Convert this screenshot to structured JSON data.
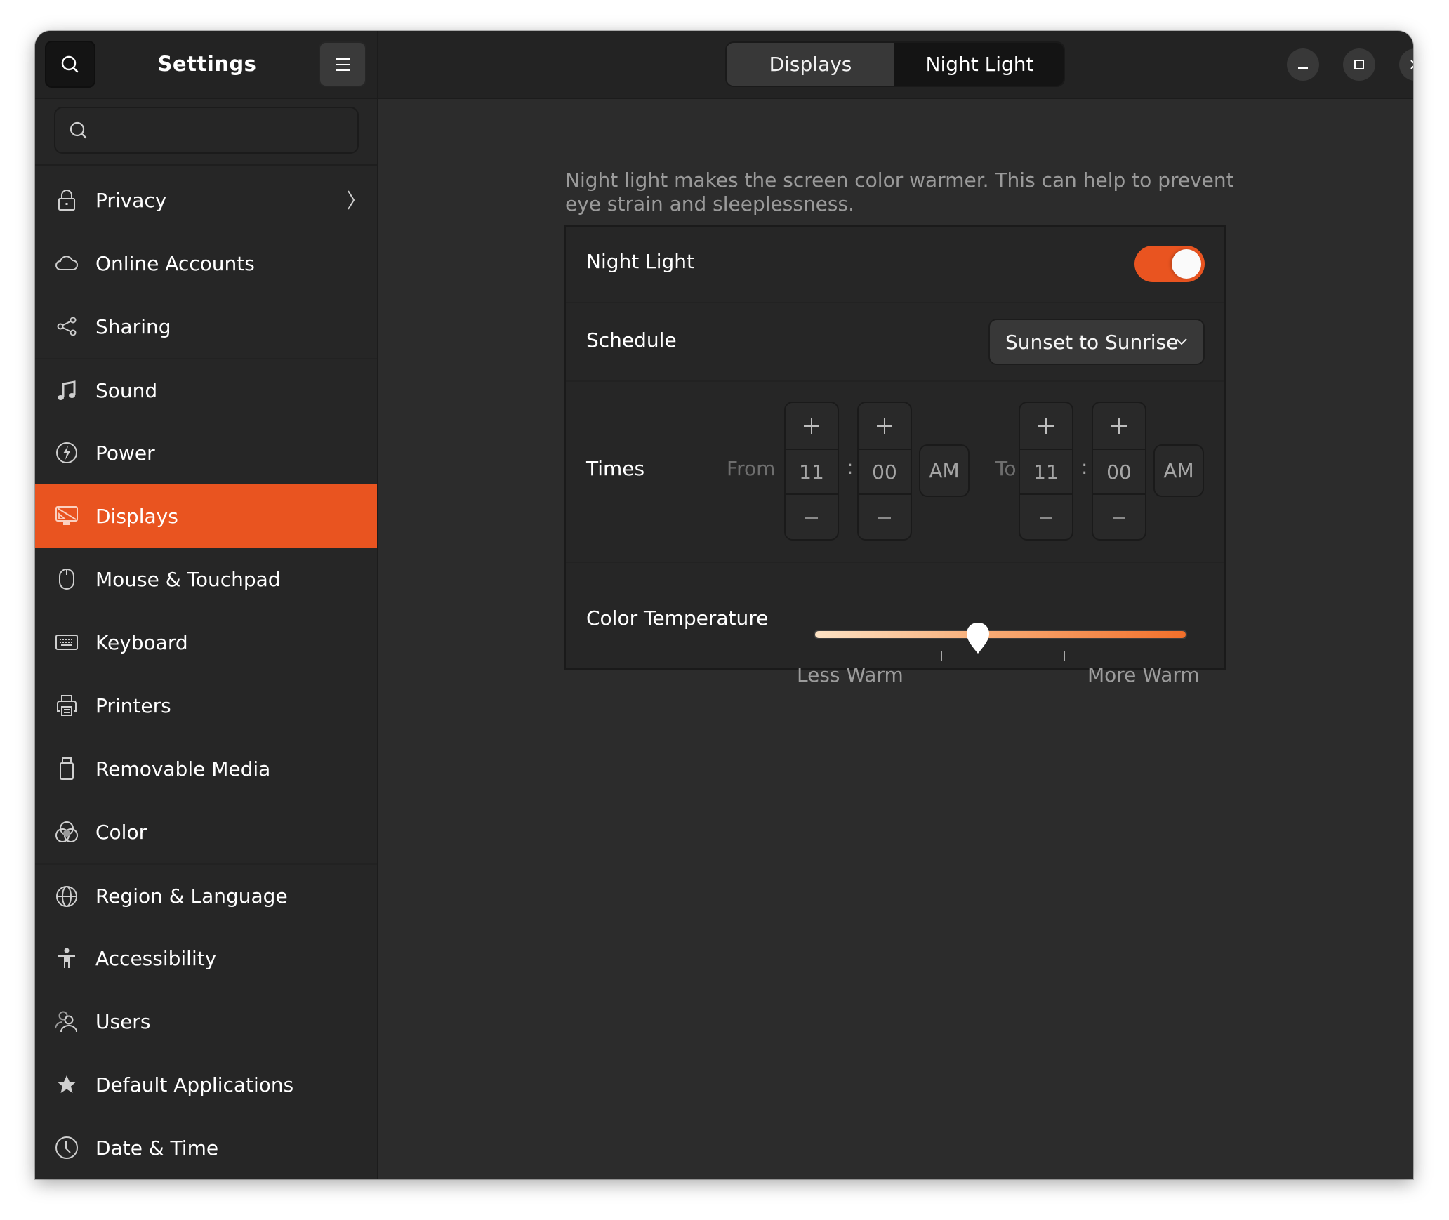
{
  "app": {
    "title": "Settings"
  },
  "sidebar": {
    "search_placeholder": "",
    "items": [
      {
        "label": "Privacy",
        "icon": "lock-icon",
        "has_chevron": true
      },
      {
        "label": "Online Accounts",
        "icon": "cloud-icon"
      },
      {
        "label": "Sharing",
        "icon": "share-icon"
      },
      {
        "label": "Sound",
        "icon": "music-note-icon"
      },
      {
        "label": "Power",
        "icon": "power-icon"
      },
      {
        "label": "Displays",
        "icon": "display-icon",
        "active": true
      },
      {
        "label": "Mouse & Touchpad",
        "icon": "mouse-icon"
      },
      {
        "label": "Keyboard",
        "icon": "keyboard-icon"
      },
      {
        "label": "Printers",
        "icon": "printer-icon"
      },
      {
        "label": "Removable Media",
        "icon": "usb-drive-icon"
      },
      {
        "label": "Color",
        "icon": "color-icon"
      },
      {
        "label": "Region & Language",
        "icon": "globe-icon"
      },
      {
        "label": "Accessibility",
        "icon": "accessibility-icon"
      },
      {
        "label": "Users",
        "icon": "users-icon"
      },
      {
        "label": "Default Applications",
        "icon": "star-icon"
      },
      {
        "label": "Date & Time",
        "icon": "clock-icon"
      }
    ]
  },
  "header": {
    "tabs": [
      {
        "label": "Displays",
        "selected": false
      },
      {
        "label": "Night Light",
        "selected": true
      }
    ],
    "window_controls": [
      "minimize",
      "maximize",
      "close"
    ]
  },
  "night_light": {
    "description": "Night light makes the screen color warmer. This can help to prevent eye strain and sleeplessness.",
    "toggle_label": "Night Light",
    "enabled": true,
    "schedule_label": "Schedule",
    "schedule_value": "Sunset to Sunrise",
    "times_label": "Times",
    "from_label": "From",
    "to_label": "To",
    "from": {
      "hour": "11",
      "minute": "00",
      "period": "AM"
    },
    "to": {
      "hour": "11",
      "minute": "00",
      "period": "AM"
    },
    "separator": ":",
    "color_temperature_label": "Color Temperature",
    "less_warm_label": "Less Warm",
    "more_warm_label": "More Warm",
    "color_temperature_fraction": 0.44,
    "tick_fractions": [
      0.34,
      0.67
    ]
  },
  "colors": {
    "accent": "#e95420",
    "window_bg": "#2c2c2c",
    "sidebar_bg": "#262626"
  }
}
